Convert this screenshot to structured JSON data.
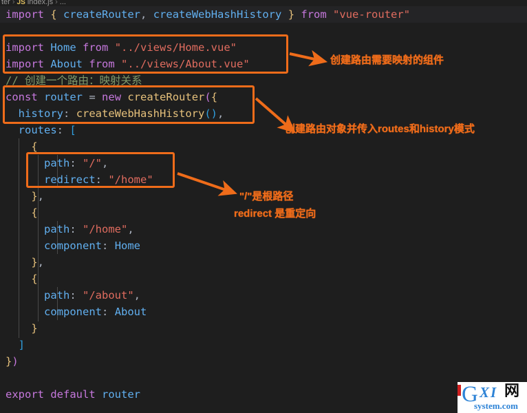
{
  "breadcrumb": {
    "part1": "ter",
    "sep": "›",
    "icon_label": "JS",
    "file": "index.js",
    "tail": "..."
  },
  "code": {
    "lines": [
      {
        "id": "l1",
        "highlight": true,
        "tokens": [
          {
            "c": "kw",
            "t": "import"
          },
          {
            "c": "white",
            "t": " "
          },
          {
            "c": "br-y",
            "t": "{"
          },
          {
            "c": "white",
            "t": " "
          },
          {
            "c": "fn",
            "t": "createRouter"
          },
          {
            "c": "punc",
            "t": ","
          },
          {
            "c": "white",
            "t": " "
          },
          {
            "c": "fn",
            "t": "createWebHashHistory"
          },
          {
            "c": "white",
            "t": " "
          },
          {
            "c": "br-y",
            "t": "}"
          },
          {
            "c": "white",
            "t": " "
          },
          {
            "c": "kw",
            "t": "from"
          },
          {
            "c": "white",
            "t": " "
          },
          {
            "c": "str",
            "t": "\"vue-router\""
          }
        ]
      },
      {
        "id": "l2",
        "tokens": []
      },
      {
        "id": "l3",
        "tokens": [
          {
            "c": "kw",
            "t": "import"
          },
          {
            "c": "white",
            "t": " "
          },
          {
            "c": "fn",
            "t": "Home"
          },
          {
            "c": "white",
            "t": " "
          },
          {
            "c": "kw",
            "t": "from"
          },
          {
            "c": "white",
            "t": " "
          },
          {
            "c": "str",
            "t": "\"../views/Home.vue\""
          }
        ]
      },
      {
        "id": "l4",
        "tokens": [
          {
            "c": "kw",
            "t": "import"
          },
          {
            "c": "white",
            "t": " "
          },
          {
            "c": "fn",
            "t": "About"
          },
          {
            "c": "white",
            "t": " "
          },
          {
            "c": "kw",
            "t": "from"
          },
          {
            "c": "white",
            "t": " "
          },
          {
            "c": "str",
            "t": "\"../views/About.vue\""
          }
        ]
      },
      {
        "id": "l5",
        "tokens": [
          {
            "c": "cmt",
            "t": "// 创建一个路由：映射关系"
          }
        ]
      },
      {
        "id": "l6",
        "tokens": [
          {
            "c": "kw",
            "t": "const"
          },
          {
            "c": "white",
            "t": " "
          },
          {
            "c": "fn",
            "t": "router"
          },
          {
            "c": "white",
            "t": " "
          },
          {
            "c": "punc",
            "t": "="
          },
          {
            "c": "white",
            "t": " "
          },
          {
            "c": "kw",
            "t": "new"
          },
          {
            "c": "white",
            "t": " "
          },
          {
            "c": "var",
            "t": "createRouter"
          },
          {
            "c": "br-m",
            "t": "("
          },
          {
            "c": "br-y",
            "t": "{"
          }
        ]
      },
      {
        "id": "l7",
        "tokens": [
          {
            "c": "white",
            "t": "  "
          },
          {
            "c": "prop",
            "t": "history"
          },
          {
            "c": "punc",
            "t": ":"
          },
          {
            "c": "white",
            "t": " "
          },
          {
            "c": "var",
            "t": "createWebHashHistory"
          },
          {
            "c": "br-b",
            "t": "()"
          },
          {
            "c": "punc",
            "t": ","
          }
        ]
      },
      {
        "id": "l8",
        "tokens": [
          {
            "c": "white",
            "t": "  "
          },
          {
            "c": "prop",
            "t": "routes"
          },
          {
            "c": "punc",
            "t": ":"
          },
          {
            "c": "white",
            "t": " "
          },
          {
            "c": "br-b",
            "t": "["
          }
        ]
      },
      {
        "id": "l9",
        "tokens": [
          {
            "c": "white",
            "t": "    "
          },
          {
            "c": "br-y",
            "t": "{"
          }
        ]
      },
      {
        "id": "l10",
        "tokens": [
          {
            "c": "white",
            "t": "      "
          },
          {
            "c": "prop",
            "t": "path"
          },
          {
            "c": "punc",
            "t": ":"
          },
          {
            "c": "white",
            "t": " "
          },
          {
            "c": "str",
            "t": "\"/\""
          },
          {
            "c": "punc",
            "t": ","
          }
        ]
      },
      {
        "id": "l11",
        "tokens": [
          {
            "c": "white",
            "t": "      "
          },
          {
            "c": "prop",
            "t": "redirect"
          },
          {
            "c": "punc",
            "t": ":"
          },
          {
            "c": "white",
            "t": " "
          },
          {
            "c": "str",
            "t": "\"/home\""
          }
        ]
      },
      {
        "id": "l12",
        "tokens": [
          {
            "c": "white",
            "t": "    "
          },
          {
            "c": "br-y",
            "t": "}"
          },
          {
            "c": "punc",
            "t": ","
          }
        ]
      },
      {
        "id": "l13",
        "tokens": [
          {
            "c": "white",
            "t": "    "
          },
          {
            "c": "br-y",
            "t": "{"
          }
        ]
      },
      {
        "id": "l14",
        "tokens": [
          {
            "c": "white",
            "t": "      "
          },
          {
            "c": "prop",
            "t": "path"
          },
          {
            "c": "punc",
            "t": ":"
          },
          {
            "c": "white",
            "t": " "
          },
          {
            "c": "str",
            "t": "\"/home\""
          },
          {
            "c": "punc",
            "t": ","
          }
        ]
      },
      {
        "id": "l15",
        "tokens": [
          {
            "c": "white",
            "t": "      "
          },
          {
            "c": "prop",
            "t": "component"
          },
          {
            "c": "punc",
            "t": ":"
          },
          {
            "c": "white",
            "t": " "
          },
          {
            "c": "fn",
            "t": "Home"
          }
        ]
      },
      {
        "id": "l16",
        "tokens": [
          {
            "c": "white",
            "t": "    "
          },
          {
            "c": "br-y",
            "t": "}"
          },
          {
            "c": "punc",
            "t": ","
          }
        ]
      },
      {
        "id": "l17",
        "tokens": [
          {
            "c": "white",
            "t": "    "
          },
          {
            "c": "br-y",
            "t": "{"
          }
        ]
      },
      {
        "id": "l18",
        "tokens": [
          {
            "c": "white",
            "t": "      "
          },
          {
            "c": "prop",
            "t": "path"
          },
          {
            "c": "punc",
            "t": ":"
          },
          {
            "c": "white",
            "t": " "
          },
          {
            "c": "str",
            "t": "\"/about\""
          },
          {
            "c": "punc",
            "t": ","
          }
        ]
      },
      {
        "id": "l19",
        "tokens": [
          {
            "c": "white",
            "t": "      "
          },
          {
            "c": "prop",
            "t": "component"
          },
          {
            "c": "punc",
            "t": ":"
          },
          {
            "c": "white",
            "t": " "
          },
          {
            "c": "fn",
            "t": "About"
          }
        ]
      },
      {
        "id": "l20",
        "tokens": [
          {
            "c": "white",
            "t": "    "
          },
          {
            "c": "br-y",
            "t": "}"
          }
        ]
      },
      {
        "id": "l21",
        "tokens": [
          {
            "c": "white",
            "t": "  "
          },
          {
            "c": "br-b",
            "t": "]"
          }
        ]
      },
      {
        "id": "l22",
        "tokens": [
          {
            "c": "br-y",
            "t": "}"
          },
          {
            "c": "br-m",
            "t": ")"
          }
        ]
      },
      {
        "id": "l23",
        "tokens": []
      },
      {
        "id": "l24",
        "tokens": [
          {
            "c": "kw",
            "t": "export"
          },
          {
            "c": "white",
            "t": " "
          },
          {
            "c": "kw",
            "t": "default"
          },
          {
            "c": "white",
            "t": " "
          },
          {
            "c": "fn",
            "t": "router"
          }
        ]
      }
    ]
  },
  "annotations": {
    "accent_color": "#ef6c1a",
    "notes": [
      {
        "id": "n1",
        "text": "创建路由需要映射的组件"
      },
      {
        "id": "n2",
        "text": "创建路由对象并传入routes和history模式"
      },
      {
        "id": "n3a",
        "text": "\"/\"是根路径"
      },
      {
        "id": "n3b",
        "text": "redirect 是重定向"
      }
    ]
  },
  "watermark": {
    "letter": "G",
    "xi": "XI",
    "cn": "网",
    "domain": "system.com"
  },
  "theme": {
    "background": "#1e1e1e",
    "highlight_line": "#242426",
    "keyword": "#c678dd",
    "identifier": "#61afef",
    "string": "#e06c5f",
    "gold": "#e5c07b",
    "comment": "#7f996a",
    "punctuation": "#abb2bf"
  }
}
